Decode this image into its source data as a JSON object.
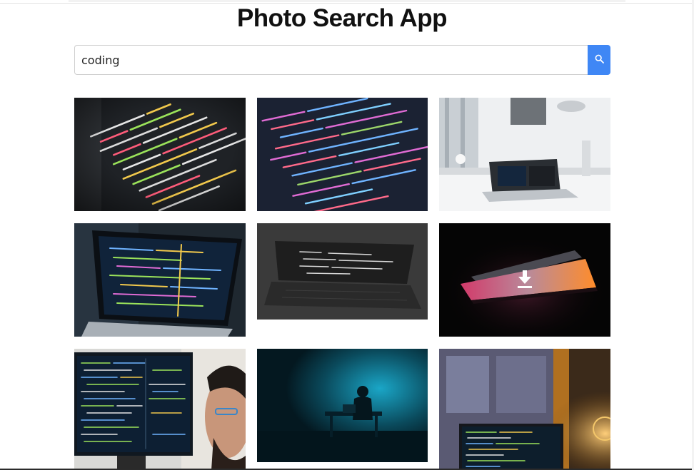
{
  "app": {
    "title": "Photo Search App"
  },
  "search": {
    "value": "coding",
    "button_icon": "search-icon"
  },
  "photos": [
    {
      "icon": "photo-code-editor-closeup"
    },
    {
      "icon": "photo-html-code-screen"
    },
    {
      "icon": "photo-laptop-on-desk"
    },
    {
      "icon": "photo-laptop-code-dark"
    },
    {
      "icon": "photo-laptop-monochrome"
    },
    {
      "icon": "photo-laptop-backlit",
      "overlay_icon": "download-icon"
    },
    {
      "icon": "photo-developer-monitor"
    },
    {
      "icon": "photo-person-cyan-light"
    },
    {
      "icon": "photo-laptop-window"
    }
  ],
  "colors": {
    "accent": "#3f87f5",
    "title": "#111111"
  }
}
